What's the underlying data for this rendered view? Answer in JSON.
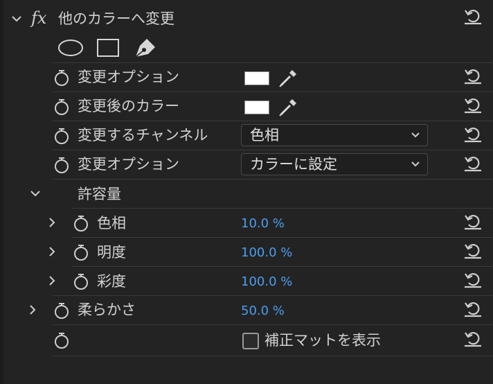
{
  "effect": {
    "fx_label": "fx",
    "title": "他のカラーへ変更"
  },
  "mask_tools": [
    "ellipse-mask-icon",
    "rectangle-mask-icon",
    "pen-mask-icon"
  ],
  "rows": {
    "change_option_color": {
      "label": "変更オプション",
      "swatch_color": "#ffffff"
    },
    "target_color": {
      "label": "変更後のカラー",
      "swatch_color": "#ffffff"
    },
    "change_channel": {
      "label": "変更するチャンネル",
      "value": "色相"
    },
    "change_option": {
      "label": "変更オプション",
      "value": "カラーに設定"
    },
    "tolerance": {
      "label": "許容量"
    },
    "hue": {
      "label": "色相",
      "value": "10.0 %"
    },
    "lightness": {
      "label": "明度",
      "value": "100.0 %"
    },
    "saturation": {
      "label": "彩度",
      "value": "100.0 %"
    },
    "softness": {
      "label": "柔らかさ",
      "value": "50.0 %"
    },
    "matte": {
      "label": "補正マットを表示",
      "checked": false
    }
  },
  "colors": {
    "background": "#232323",
    "value_blue": "#4b9ef0",
    "text": "#d2d2d2"
  }
}
